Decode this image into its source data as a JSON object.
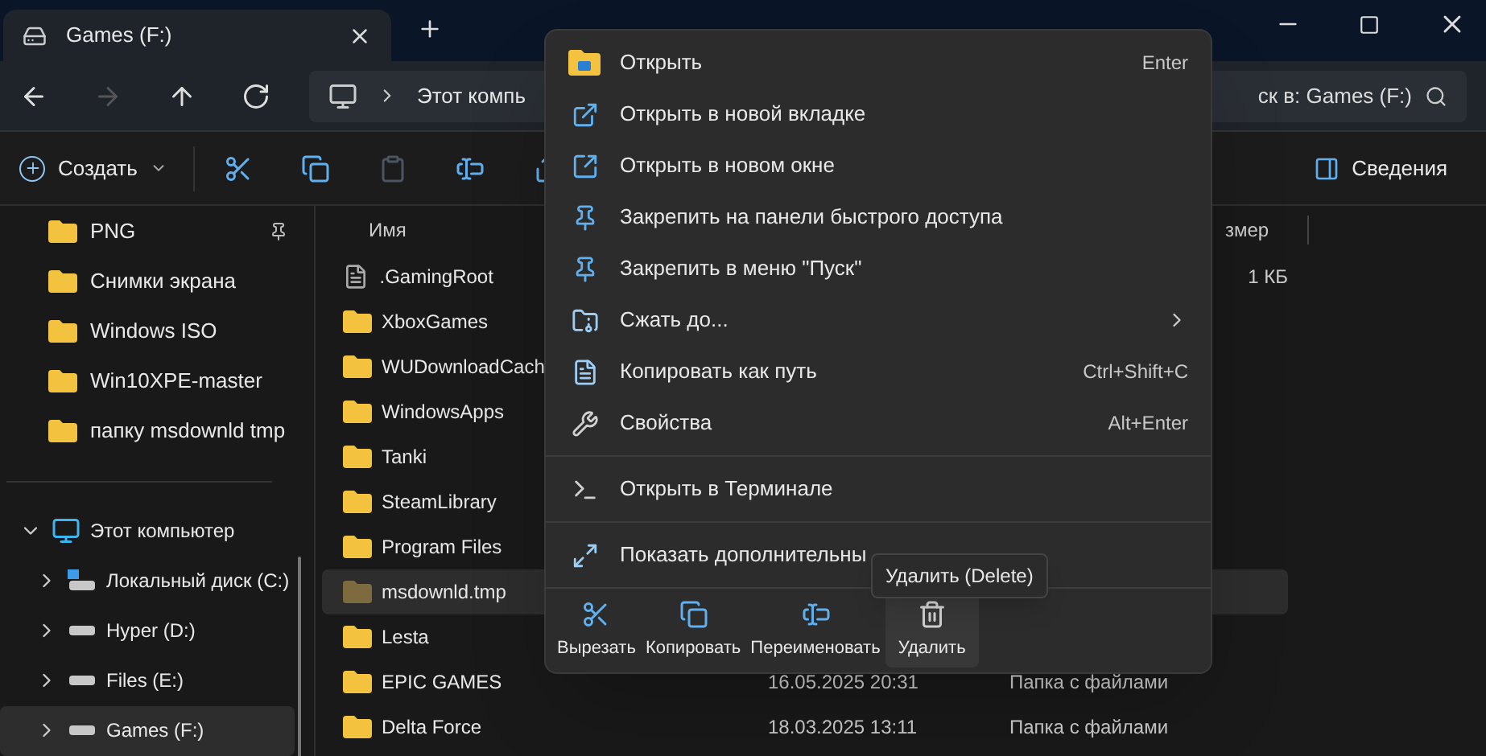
{
  "tabs": [
    {
      "title": "Games (F:)",
      "selected": true
    }
  ],
  "nav": {
    "buttons": [
      {
        "disabled": false
      },
      {
        "disabled": true
      },
      {
        "disabled": false
      },
      {
        "disabled": false
      }
    ],
    "breadcrumb": "Этот компь",
    "search_placeholder": "ск в: Games (F:)"
  },
  "toolbar": {
    "create": "Создать",
    "actions": [
      {
        "disabled": false
      },
      {
        "disabled": false
      },
      {
        "disabled": true
      },
      {
        "disabled": false
      },
      {
        "disabled": false
      }
    ],
    "details": "Сведения"
  },
  "sidebar": {
    "quick_access": [
      {
        "label": "PNG",
        "pinned": true
      },
      {
        "label": "Снимки экрана",
        "pinned": false
      },
      {
        "label": "Windows ISO",
        "pinned": false
      },
      {
        "label": "Win10XPE-master",
        "pinned": false
      },
      {
        "label": "папку msdownld tmp",
        "pinned": false
      }
    ],
    "tree": [
      {
        "label": "Этот компьютер",
        "kind": "computer",
        "expanded": true,
        "selected": false,
        "children": [
          {
            "label": "Локальный диск (C:)",
            "kind": "system-drive",
            "expanded": false,
            "selected": false
          },
          {
            "label": "Hyper (D:)",
            "kind": "drive",
            "expanded": false,
            "selected": false
          },
          {
            "label": "Files (E:)",
            "kind": "drive",
            "expanded": false,
            "selected": false
          },
          {
            "label": "Games (F:)",
            "kind": "drive",
            "expanded": false,
            "selected": true
          }
        ]
      }
    ]
  },
  "file_list": {
    "columns": [
      "Имя",
      "змер"
    ],
    "rows": [
      {
        "name": ".GamingRoot",
        "kind": "file",
        "selected": false,
        "size": "1 КБ"
      },
      {
        "name": "XboxGames",
        "kind": "folder",
        "selected": false
      },
      {
        "name": "WUDownloadCach",
        "kind": "folder",
        "selected": false
      },
      {
        "name": "WindowsApps",
        "kind": "folder",
        "selected": false
      },
      {
        "name": "Tanki",
        "kind": "folder",
        "selected": false
      },
      {
        "name": "SteamLibrary",
        "kind": "folder",
        "selected": false
      },
      {
        "name": "Program Files",
        "kind": "folder",
        "selected": false
      },
      {
        "name": "msdownld.tmp",
        "kind": "hidden-folder",
        "selected": true
      },
      {
        "name": "Lesta",
        "kind": "folder",
        "selected": false
      },
      {
        "name": "EPIC GAMES",
        "kind": "folder",
        "selected": false,
        "date": "16.05.2025 20:31",
        "type": "Папка с файлами"
      },
      {
        "name": "Delta Force",
        "kind": "folder",
        "selected": false,
        "date": "18.03.2025 13:11",
        "type": "Папка с файлами"
      }
    ]
  },
  "context_menu": {
    "groups": [
      [
        {
          "label": "Открыть",
          "shortcut": "Enter",
          "submenu": false
        },
        {
          "label": "Открыть в новой вкладке",
          "submenu": false
        },
        {
          "label": "Открыть в новом окне",
          "submenu": false
        },
        {
          "label": "Закрепить на панели быстрого доступа",
          "submenu": false
        },
        {
          "label": "Закрепить в меню \"Пуск\"",
          "submenu": false
        },
        {
          "label": "Сжать до...",
          "submenu": true
        },
        {
          "label": "Копировать как путь",
          "shortcut": "Ctrl+Shift+C",
          "submenu": false
        },
        {
          "label": "Свойства",
          "shortcut": "Alt+Enter",
          "submenu": false
        }
      ],
      [
        {
          "label": "Открыть в Терминале",
          "submenu": false
        }
      ],
      [
        {
          "label": "Показать дополнительны",
          "submenu": false
        }
      ]
    ],
    "actions": [
      {
        "label": "Вырезать",
        "hovered": false
      },
      {
        "label": "Копировать",
        "hovered": false
      },
      {
        "label": "Переименовать",
        "hovered": false
      },
      {
        "label": "Удалить",
        "hovered": true
      }
    ],
    "tooltip": "Удалить (Delete)"
  }
}
